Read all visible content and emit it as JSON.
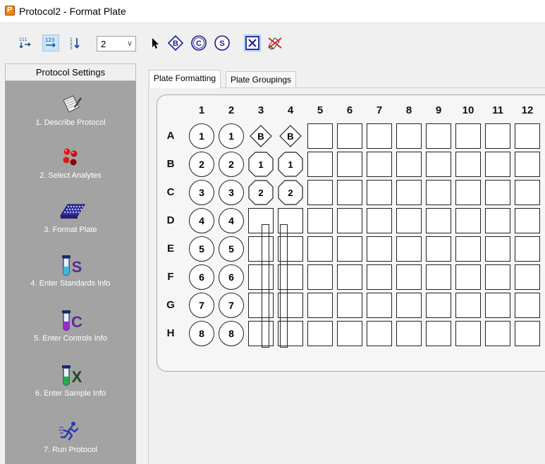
{
  "window": {
    "title": "Protocol2 - Format Plate"
  },
  "toolbar": {
    "replicate_value": "2",
    "icons": [
      "fill-down-numbering-icon",
      "fill-across-numbering-icon",
      "fill-sequence-icon",
      "pointer-icon",
      "blank-well-icon",
      "control-well-icon",
      "standard-well-icon",
      "sample-well-icon",
      "clear-wells-icon"
    ],
    "blank_label": "B",
    "control_label": "C",
    "standard_label": "S"
  },
  "sidebar": {
    "header": "Protocol Settings",
    "steps": [
      {
        "label": "1. Describe Protocol",
        "icon": "notepad-icon"
      },
      {
        "label": "2. Select Analytes",
        "icon": "beads-icon"
      },
      {
        "label": "3. Format Plate",
        "icon": "plate-icon"
      },
      {
        "label": "4. Enter Standards Info",
        "icon": "tube-s-icon",
        "letter": "S"
      },
      {
        "label": "5. Enter Controls Info",
        "icon": "tube-c-icon",
        "letter": "C"
      },
      {
        "label": "6. Enter Sample Info",
        "icon": "tube-x-icon",
        "letter": "X"
      },
      {
        "label": "7. Run Protocol",
        "icon": "runner-icon"
      }
    ]
  },
  "tabs": [
    {
      "label": "Plate Formatting",
      "active": true
    },
    {
      "label": "Plate Groupings",
      "active": false
    }
  ],
  "plate": {
    "columns": [
      "1",
      "2",
      "3",
      "4",
      "5",
      "6",
      "7",
      "8",
      "9",
      "10",
      "11",
      "12"
    ],
    "rows": [
      "A",
      "B",
      "C",
      "D",
      "E",
      "F",
      "G",
      "H"
    ],
    "wells": {
      "A": [
        {
          "t": "S",
          "v": "1"
        },
        {
          "t": "S",
          "v": "1"
        },
        {
          "t": "B",
          "v": "B"
        },
        {
          "t": "B",
          "v": "B"
        }
      ],
      "B": [
        {
          "t": "S",
          "v": "2"
        },
        {
          "t": "S",
          "v": "2"
        },
        {
          "t": "X",
          "v": "1"
        },
        {
          "t": "X",
          "v": "1"
        }
      ],
      "C": [
        {
          "t": "S",
          "v": "3"
        },
        {
          "t": "S",
          "v": "3"
        },
        {
          "t": "X",
          "v": "2"
        },
        {
          "t": "X",
          "v": "2"
        }
      ],
      "D": [
        {
          "t": "S",
          "v": "4"
        },
        {
          "t": "S",
          "v": "4"
        }
      ],
      "E": [
        {
          "t": "S",
          "v": "5"
        },
        {
          "t": "S",
          "v": "5"
        }
      ],
      "F": [
        {
          "t": "S",
          "v": "6"
        },
        {
          "t": "S",
          "v": "6"
        }
      ],
      "G": [
        {
          "t": "S",
          "v": "7"
        },
        {
          "t": "S",
          "v": "7"
        }
      ],
      "H": [
        {
          "t": "S",
          "v": "8"
        },
        {
          "t": "S",
          "v": "8"
        }
      ]
    }
  }
}
